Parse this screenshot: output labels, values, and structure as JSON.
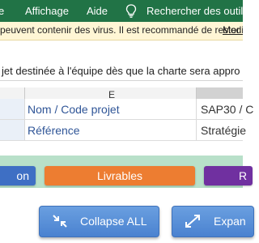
{
  "ribbon": {
    "menu_items": [
      "Affichage",
      "Aide"
    ],
    "first_item_partial": "e",
    "search_placeholder": "Rechercher des outils a"
  },
  "warning_bar": {
    "message": "peuvent contenir des virus. Il est recommandé de rester en",
    "link_text": "Modif"
  },
  "formula_bar": {
    "content": "jet destinée à l'équipe dès que la charte sera appro"
  },
  "grid": {
    "column_header": "E",
    "rows": [
      {
        "label": "Nom / Code projet",
        "value": "SAP30 / C"
      },
      {
        "label": "Référence",
        "value": "Stratégie"
      }
    ]
  },
  "nav_tabs": {
    "left": "on",
    "center": "Livrables",
    "right": "R"
  },
  "buttons": {
    "collapse": "Collapse ALL",
    "expand": "Expan"
  },
  "colors": {
    "ribbon": "#217346",
    "warning_bg": "#fff6d5",
    "band": "#b8e0c9",
    "tab_blue": "#3e6fc4",
    "tab_orange": "#ed7d31",
    "tab_purple": "#7030a0",
    "label_blue": "#2f5597",
    "button_blue": "#4a82d0"
  }
}
